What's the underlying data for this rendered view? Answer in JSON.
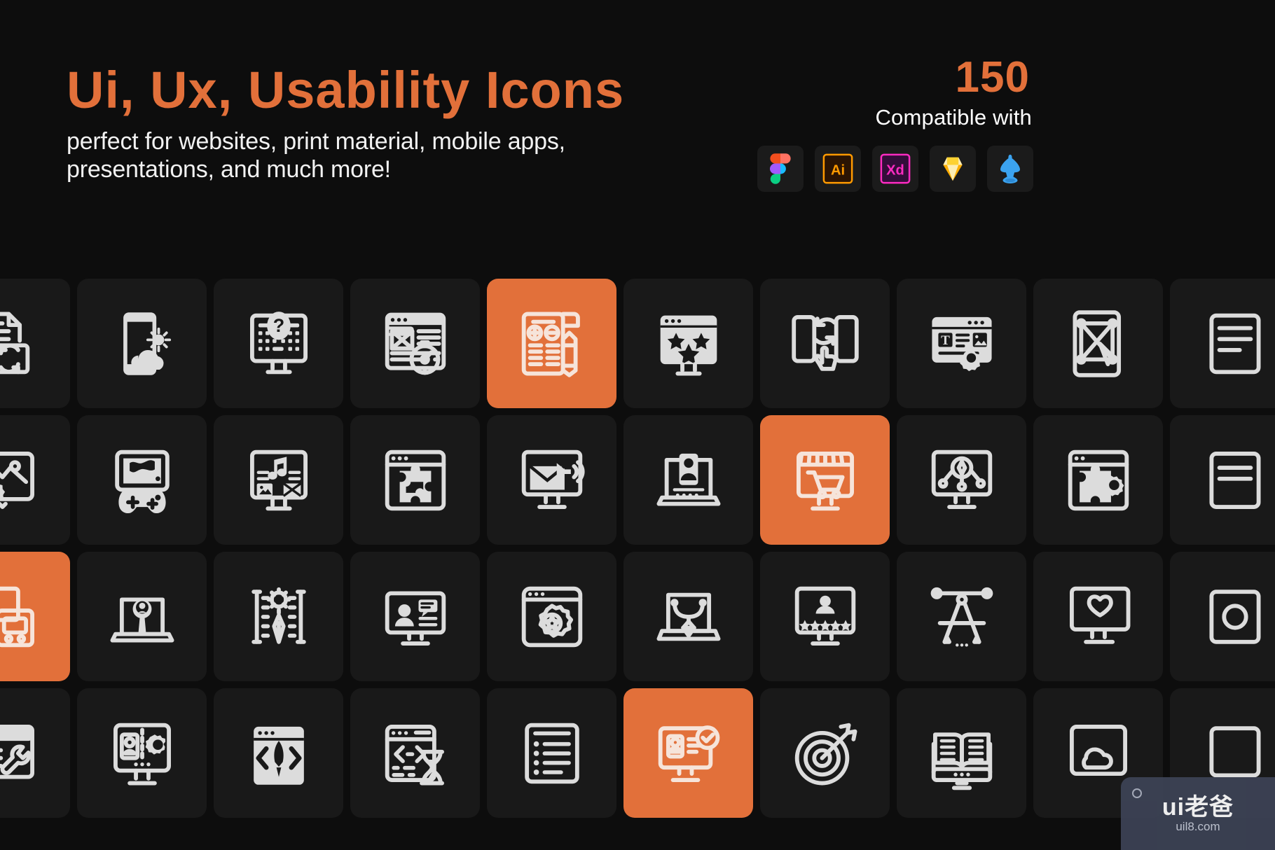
{
  "header": {
    "title": "Ui, Ux, Usability Icons",
    "subtitle": "perfect for websites, print material, mobile apps,\npresentations, and much more!",
    "count": "150",
    "compatible_label": "Compatible with",
    "apps": [
      {
        "name": "figma",
        "label": "Figma"
      },
      {
        "name": "illustrator",
        "label": "Ai"
      },
      {
        "name": "xd",
        "label": "Xd"
      },
      {
        "name": "sketch",
        "label": "Sketch"
      },
      {
        "name": "inkscape",
        "label": "Inkscape"
      }
    ]
  },
  "colors": {
    "accent": "#e2703a",
    "background": "#0d0d0d",
    "tile": "#191919",
    "icon": "#dcdcdc",
    "watermark_bg": "#3d4356"
  },
  "grid": {
    "columns": 10,
    "rows": 4,
    "tile_size": 185,
    "tile_pitch": 195,
    "tile_radius": 16,
    "items": [
      {
        "row": 0,
        "col": 0,
        "name": "document-sync-icon",
        "accent": false
      },
      {
        "row": 0,
        "col": 1,
        "name": "mobile-weather-icon",
        "accent": false
      },
      {
        "row": 0,
        "col": 2,
        "name": "desktop-help-faq-icon",
        "accent": false
      },
      {
        "row": 0,
        "col": 3,
        "name": "wireframe-speed-icon",
        "accent": false
      },
      {
        "row": 0,
        "col": 4,
        "name": "content-edit-pencil-icon",
        "accent": true
      },
      {
        "row": 0,
        "col": 5,
        "name": "browser-favorites-stars-icon",
        "accent": false
      },
      {
        "row": 0,
        "col": 6,
        "name": "responsive-tap-sync-icon",
        "accent": false
      },
      {
        "row": 0,
        "col": 7,
        "name": "text-image-settings-icon",
        "accent": false
      },
      {
        "row": 0,
        "col": 8,
        "name": "mobile-vector-edit-icon",
        "accent": false
      },
      {
        "row": 1,
        "col": 0,
        "name": "browser-settings-gear-icon",
        "accent": false
      },
      {
        "row": 1,
        "col": 1,
        "name": "game-controller-icon",
        "accent": false
      },
      {
        "row": 1,
        "col": 2,
        "name": "media-music-gallery-icon",
        "accent": false
      },
      {
        "row": 1,
        "col": 3,
        "name": "browser-puzzle-plugin-icon",
        "accent": false
      },
      {
        "row": 1,
        "col": 4,
        "name": "desktop-email-sound-icon",
        "accent": false
      },
      {
        "row": 1,
        "col": 5,
        "name": "laptop-user-profile-icon",
        "accent": false
      },
      {
        "row": 1,
        "col": 6,
        "name": "ecommerce-shop-cart-icon",
        "accent": true
      },
      {
        "row": 1,
        "col": 7,
        "name": "desktop-network-node-icon",
        "accent": false
      },
      {
        "row": 1,
        "col": 8,
        "name": "browser-puzzle-settings-icon",
        "accent": false
      },
      {
        "row": 2,
        "col": 0,
        "name": "responsive-devices-icon",
        "accent": true
      },
      {
        "row": 2,
        "col": 1,
        "name": "laptop-user-search-icon",
        "accent": false
      },
      {
        "row": 2,
        "col": 2,
        "name": "design-tools-settings-icon",
        "accent": false
      },
      {
        "row": 2,
        "col": 3,
        "name": "video-chat-user-icon",
        "accent": false
      },
      {
        "row": 2,
        "col": 4,
        "name": "browser-gear-star-icon",
        "accent": false
      },
      {
        "row": 2,
        "col": 5,
        "name": "laptop-pen-tool-icon",
        "accent": false
      },
      {
        "row": 2,
        "col": 6,
        "name": "user-rating-stars-icon",
        "accent": false
      },
      {
        "row": 2,
        "col": 7,
        "name": "compass-drafting-icon",
        "accent": false
      },
      {
        "row": 2,
        "col": 8,
        "name": "desktop-favorite-heart-icon",
        "accent": false
      },
      {
        "row": 3,
        "col": 0,
        "name": "browser-wrench-tools-icon",
        "accent": false
      },
      {
        "row": 3,
        "col": 1,
        "name": "user-profile-settings-icon",
        "accent": false
      },
      {
        "row": 3,
        "col": 2,
        "name": "code-rocket-launch-icon",
        "accent": false
      },
      {
        "row": 3,
        "col": 3,
        "name": "code-hourglass-loading-icon",
        "accent": false
      },
      {
        "row": 3,
        "col": 4,
        "name": "list-bullet-content-icon",
        "accent": false
      },
      {
        "row": 3,
        "col": 5,
        "name": "user-verified-check-icon",
        "accent": true
      },
      {
        "row": 3,
        "col": 6,
        "name": "target-arrow-goal-icon",
        "accent": false
      },
      {
        "row": 3,
        "col": 7,
        "name": "open-book-reading-icon",
        "accent": false
      },
      {
        "row": 3,
        "col": 8,
        "name": "browser-cloud-icon",
        "accent": false
      }
    ]
  },
  "watermark": {
    "main": "ui老爸",
    "sub": "uil8.com"
  }
}
